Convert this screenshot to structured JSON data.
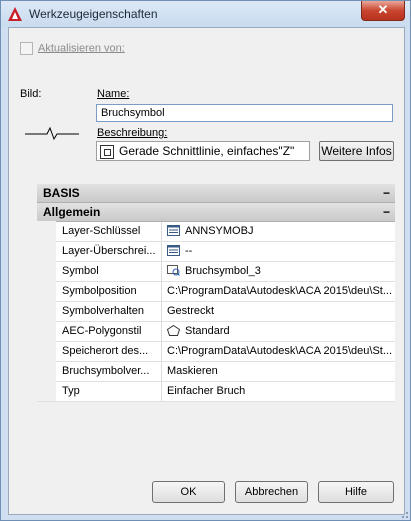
{
  "window": {
    "title": "Werkzeugeigenschaften",
    "close_label": "✕"
  },
  "update_from": {
    "label": "Aktualisieren von:",
    "checked": false
  },
  "image_label": "Bild:",
  "name": {
    "label": "Name:",
    "value": "Bruchsymbol"
  },
  "description": {
    "label": "Beschreibung:",
    "value": "Gerade Schnittlinie, einfaches\"Z\""
  },
  "more_info_button": "Weitere Infos",
  "grid": {
    "category_basis": "BASIS",
    "category_general": "Allgemein",
    "collapse_glyph": "−",
    "rows": [
      {
        "key": "Layer-Schlüssel",
        "value": "ANNSYMOBJ",
        "icon": "layer-list-icon"
      },
      {
        "key": "Layer-Überschrei...",
        "value": "--",
        "icon": "layer-list-icon"
      },
      {
        "key": "Symbol",
        "value": "Bruchsymbol_3",
        "icon": "symbol-browser-icon"
      },
      {
        "key": "Symbolposition",
        "value": "C:\\ProgramData\\Autodesk\\ACA 2015\\deu\\St...",
        "icon": ""
      },
      {
        "key": "Symbolverhalten",
        "value": "Gestreckt",
        "icon": ""
      },
      {
        "key": "AEC-Polygonstil",
        "value": "Standard",
        "icon": "polygon-icon"
      },
      {
        "key": "Speicherort des...",
        "value": "C:\\ProgramData\\Autodesk\\ACA 2015\\deu\\St...",
        "icon": ""
      },
      {
        "key": "Bruchsymbolver...",
        "value": "Maskieren",
        "icon": ""
      },
      {
        "key": "Typ",
        "value": "Einfacher Bruch",
        "icon": ""
      }
    ]
  },
  "buttons": {
    "ok": "OK",
    "cancel": "Abbrechen",
    "help": "Hilfe"
  }
}
